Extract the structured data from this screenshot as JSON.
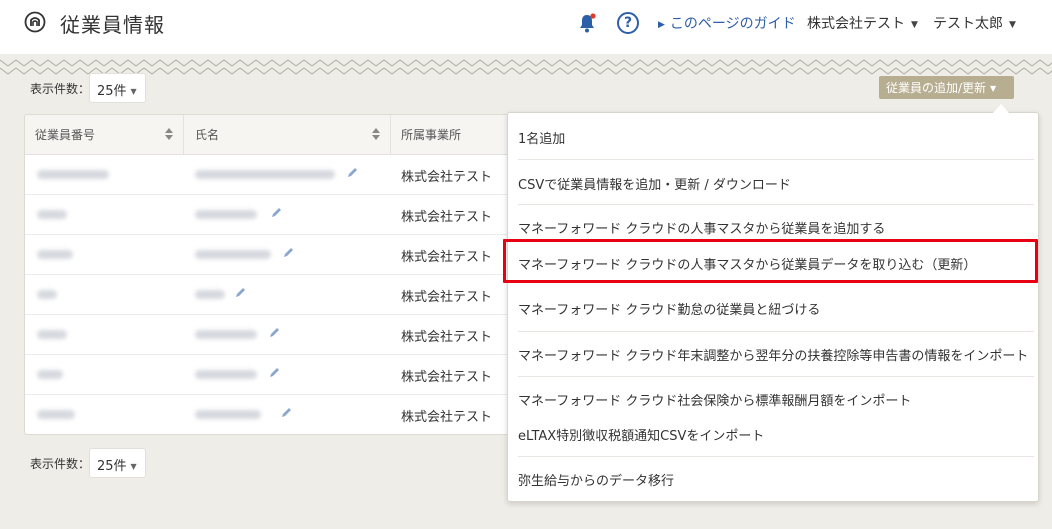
{
  "header": {
    "title": "従業員情報",
    "guide_link": "このページのガイド",
    "company": "株式会社テスト",
    "user": "テスト太郎",
    "help_symbol": "?"
  },
  "per_page": {
    "label": "表示件数：",
    "value": "25件"
  },
  "add_button": {
    "label": "従業員の追加/更新"
  },
  "table": {
    "columns": [
      "従業員番号",
      "氏名",
      "所属事業所"
    ],
    "rows": [
      {
        "office": "株式会社テスト"
      },
      {
        "office": "株式会社テスト"
      },
      {
        "office": "株式会社テスト"
      },
      {
        "office": "株式会社テスト"
      },
      {
        "office": "株式会社テスト"
      },
      {
        "office": "株式会社テスト"
      },
      {
        "office": "株式会社テスト"
      }
    ]
  },
  "dropdown": {
    "items": [
      "1名追加",
      "CSVで従業員情報を追加・更新 / ダウンロード",
      "マネーフォワード クラウドの人事マスタから従業員を追加する",
      "マネーフォワード クラウドの人事マスタから従業員データを取り込む（更新）",
      "マネーフォワード クラウド勤怠の従業員と紐づける",
      "マネーフォワード クラウド年末調整から翌年分の扶養控除等申告書の情報をインポート",
      "マネーフォワード クラウド社会保険から標準報酬月額をインポート",
      "eLTAX特別徴収税額通知CSVをインポート",
      "弥生給与からのデータ移行"
    ]
  },
  "colors": {
    "accent_blue": "#2d5fa8",
    "button_tan": "#b7ad91",
    "highlight_red": "#e60012",
    "background": "#efede7"
  },
  "icons": [
    "logo-icon",
    "bell-icon",
    "help-icon",
    "sort-icon",
    "edit-icon",
    "caret-down-icon"
  ]
}
